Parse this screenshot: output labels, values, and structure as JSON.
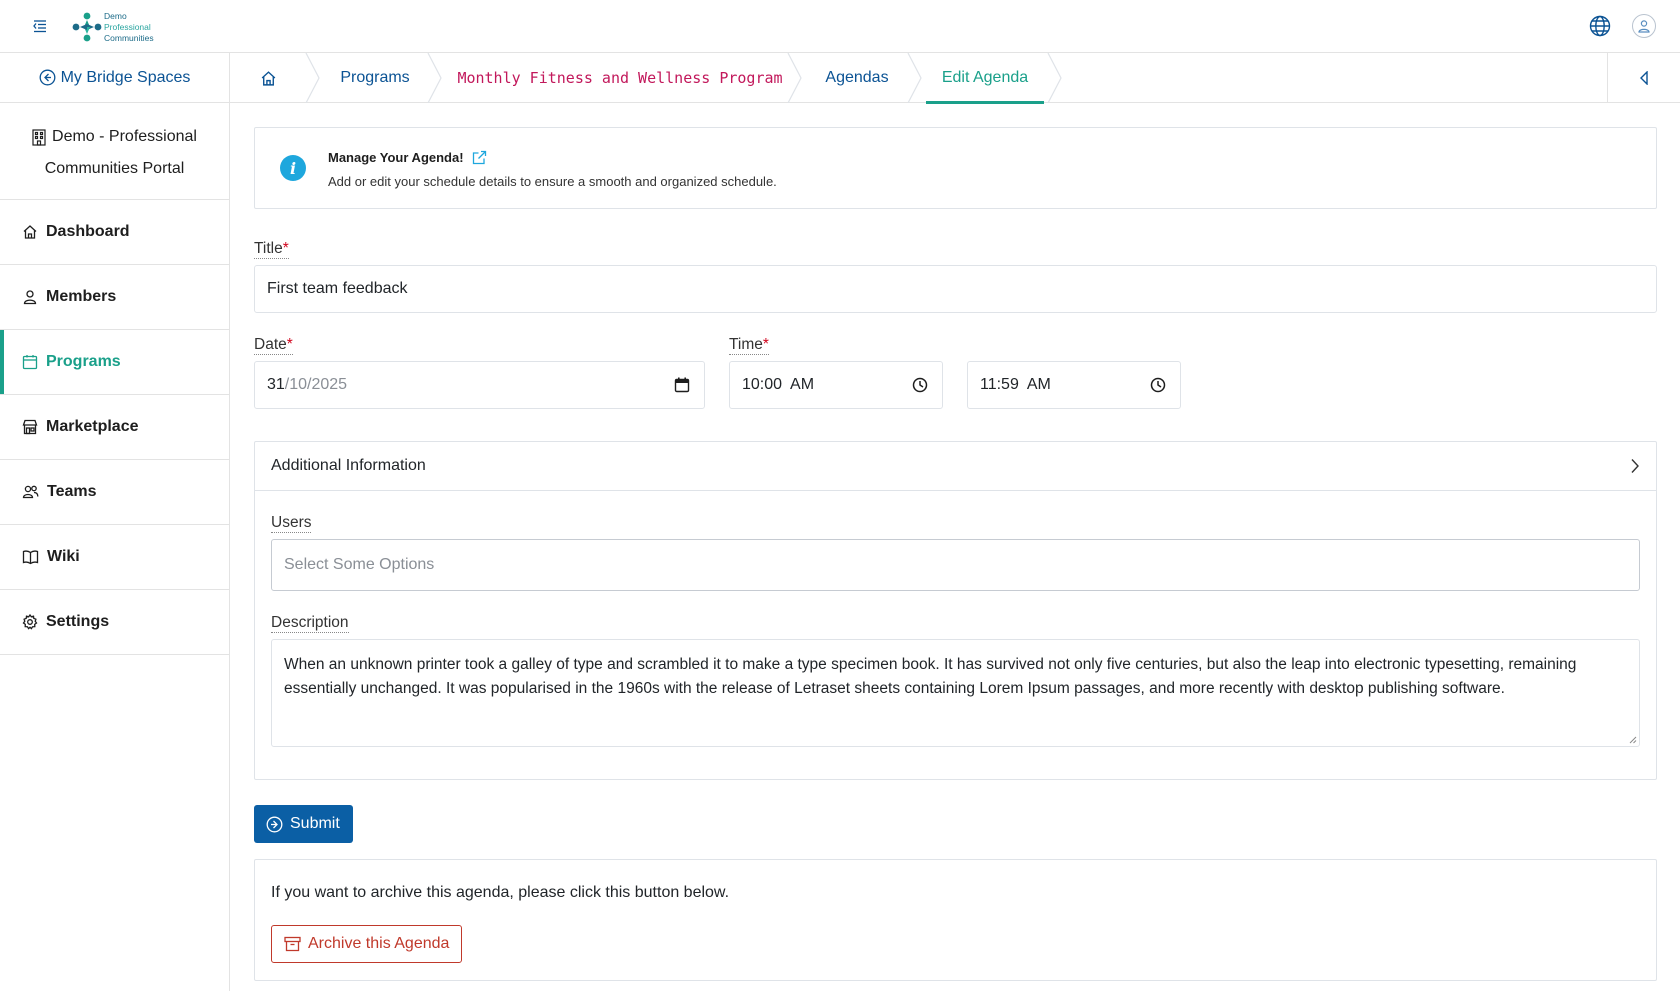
{
  "header": {
    "logo": {
      "line1": "Demo",
      "line2": "Professional",
      "line3": "Communities"
    },
    "icons": [
      "menu-toggle-icon",
      "globe-icon",
      "user-icon"
    ]
  },
  "sidebar": {
    "back_label": "My Bridge Spaces",
    "org_line1": "Demo - Professional",
    "org_line2": "Communities Portal",
    "items": [
      {
        "label": "Dashboard",
        "icon": "home-icon"
      },
      {
        "label": "Members",
        "icon": "person-icon"
      },
      {
        "label": "Programs",
        "icon": "calendar-icon",
        "active": true
      },
      {
        "label": "Marketplace",
        "icon": "store-icon"
      },
      {
        "label": "Teams",
        "icon": "people-icon"
      },
      {
        "label": "Wiki",
        "icon": "book-icon"
      },
      {
        "label": "Settings",
        "icon": "gear-icon"
      }
    ]
  },
  "breadcrumb": {
    "items": [
      {
        "label": "",
        "icon": "home-icon"
      },
      {
        "label": "Programs"
      },
      {
        "label": "Monthly Fitness and Wellness Program"
      },
      {
        "label": "Agendas"
      },
      {
        "label": "Edit Agenda",
        "active": true
      }
    ]
  },
  "info": {
    "title": "Manage Your Agenda!",
    "subtitle": "Add or edit your schedule details to ensure a smooth and organized schedule."
  },
  "form": {
    "title_label": "Title",
    "title_value": "First team feedback",
    "date_label": "Date",
    "date_day": "31",
    "date_rest": "/10/2025",
    "time_label": "Time",
    "time_start": "10:00  AM",
    "time_end": "11:59  AM",
    "required_mark": "*",
    "additional_label": "Additional Information",
    "users_label": "Users",
    "users_placeholder": "Select Some Options",
    "description_label": "Description",
    "description_value": "When an unknown printer took a galley of type and scrambled it to make a type specimen book. It has survived not only five centuries, but also the leap into electronic typesetting, remaining essentially unchanged. It was popularised in the 1960s with the release of Letraset sheets containing Lorem Ipsum passages, and more recently with desktop publishing software.",
    "submit_label": "Submit"
  },
  "archive": {
    "text": "If you want to archive this agenda, please click this button below.",
    "button_label": "Archive this Agenda"
  },
  "colors": {
    "accent": "#1aa08a",
    "primary": "#0b5fa5",
    "link": "#0b5394",
    "danger": "#c0392b",
    "program_crumb": "#c2185b"
  }
}
